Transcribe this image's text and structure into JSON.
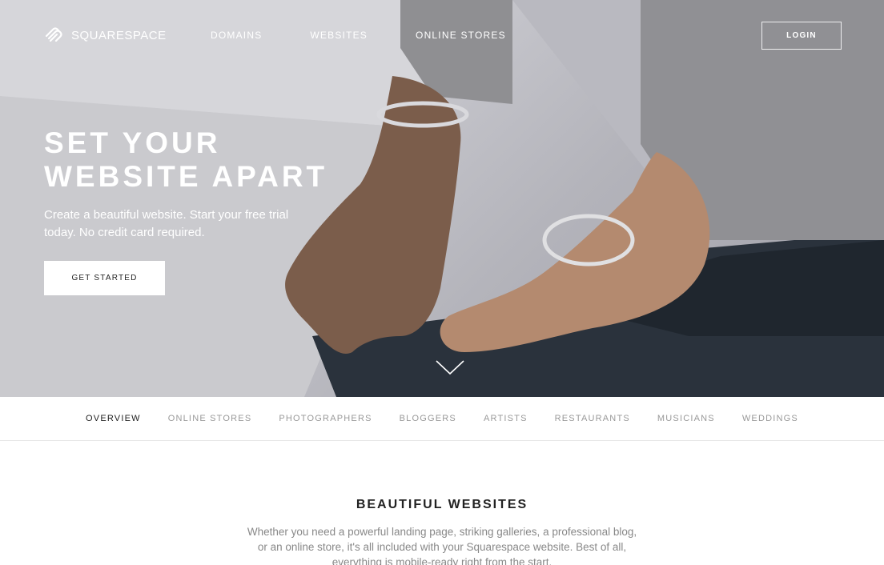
{
  "brand": {
    "name": "SQUARESPACE",
    "logo_icon": "squarespace-logo-icon"
  },
  "nav": {
    "items": [
      "DOMAINS",
      "WEBSITES",
      "ONLINE STORES"
    ],
    "login_label": "LOGIN"
  },
  "hero": {
    "title_line1": "SET YOUR",
    "title_line2": "WEBSITE APART",
    "subtitle": "Create a beautiful website. Start your free trial today. No credit card required.",
    "cta_label": "GET STARTED",
    "scroll_icon": "chevron-down-icon"
  },
  "tabs": {
    "items": [
      "OVERVIEW",
      "ONLINE STORES",
      "PHOTOGRAPHERS",
      "BLOGGERS",
      "ARTISTS",
      "RESTAURANTS",
      "MUSICIANS",
      "WEDDINGS"
    ],
    "active": "OVERVIEW"
  },
  "section": {
    "title": "BEAUTIFUL WEBSITES",
    "body": "Whether you need a powerful landing page, striking galleries, a professional blog, or an online store, it's all included with your Squarespace website. Best of all, everything is mobile-ready right from the start."
  },
  "colors": {
    "text_dark": "#222222",
    "text_muted": "#999999",
    "white": "#ffffff"
  }
}
